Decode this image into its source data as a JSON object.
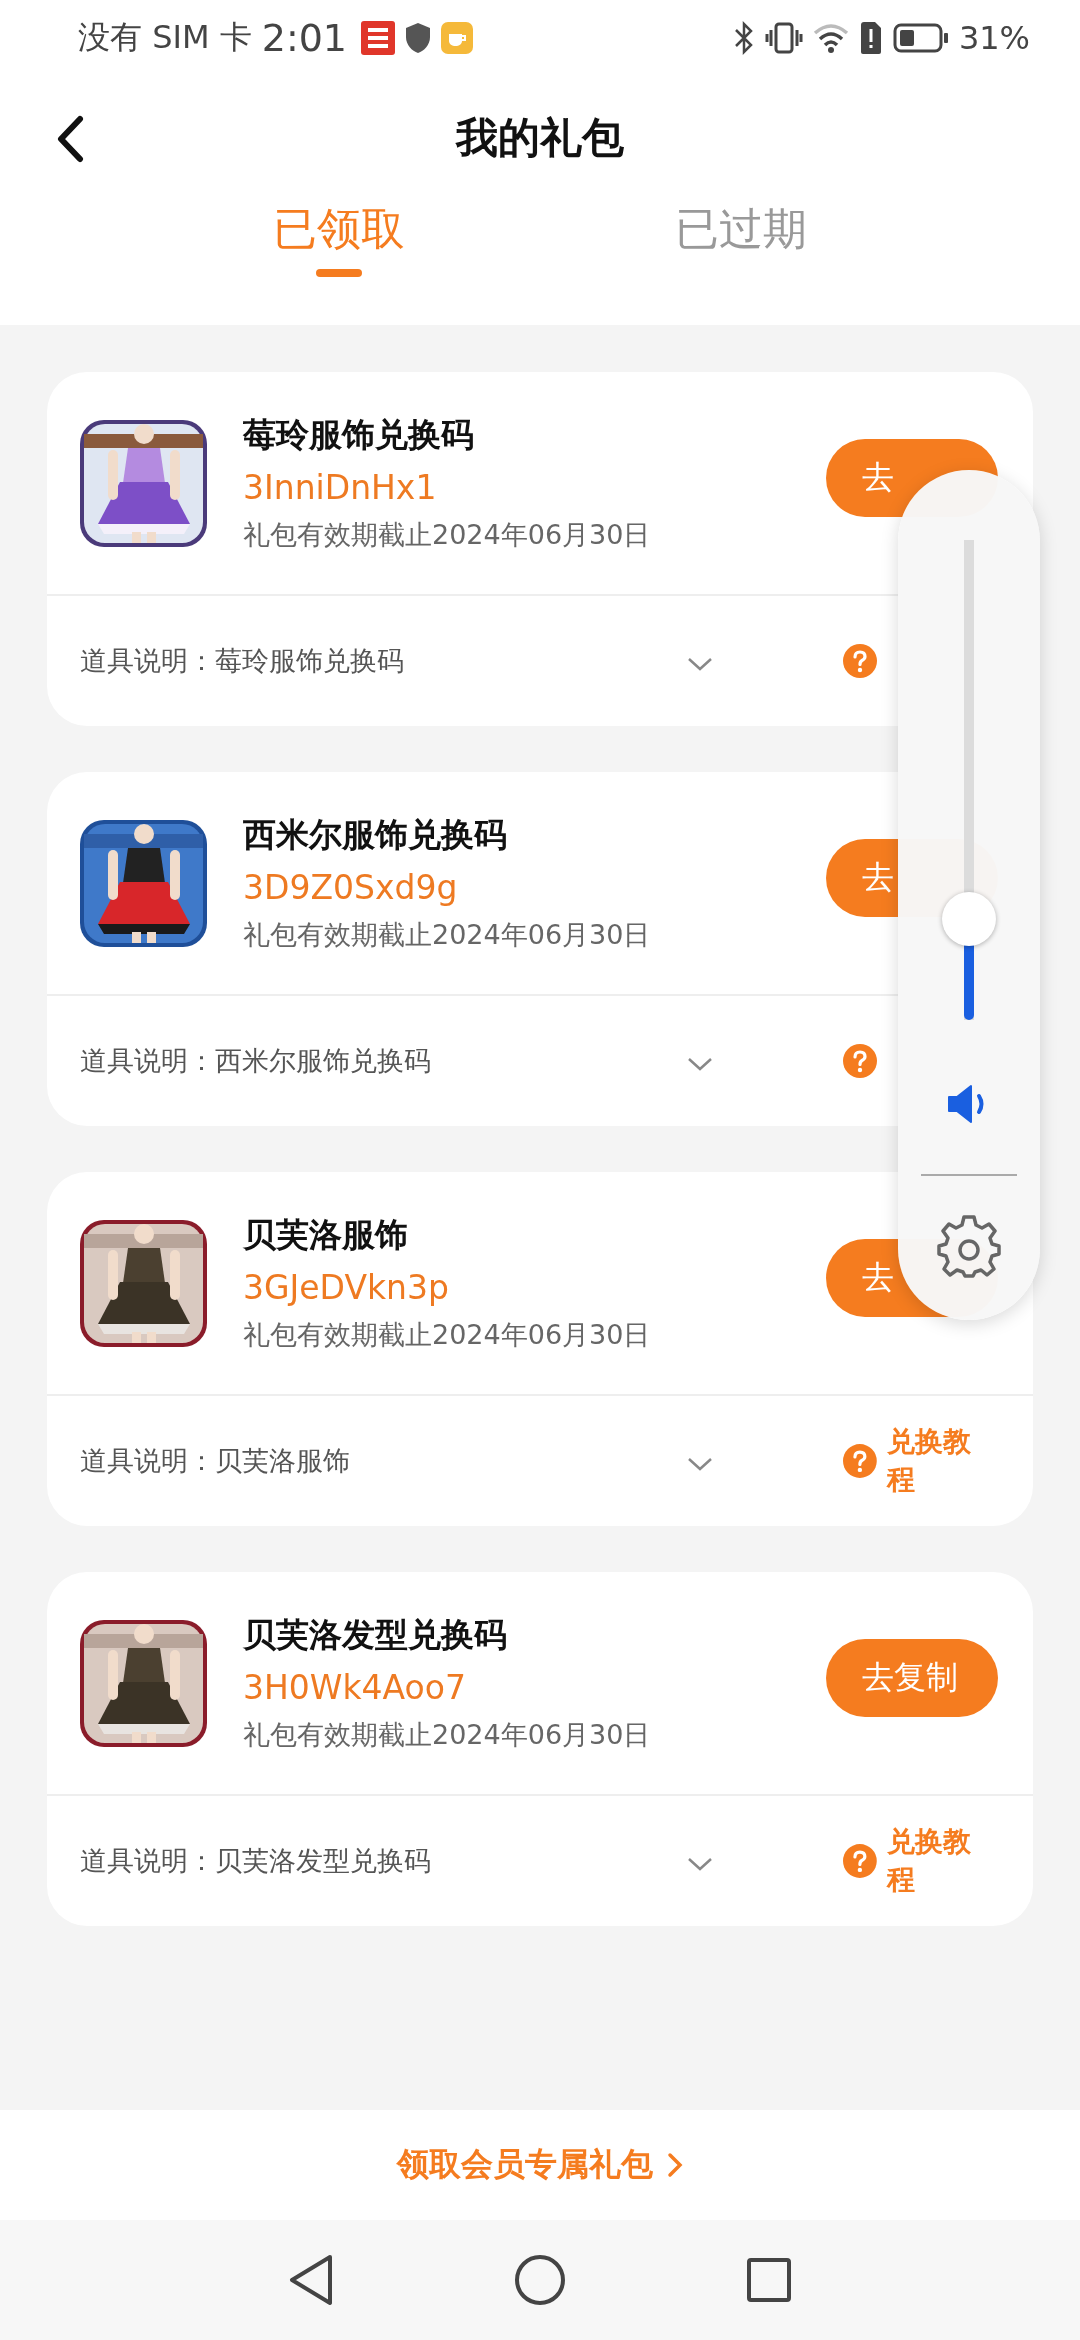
{
  "status_bar": {
    "carrier": "没有 SIM 卡",
    "time": "2:01",
    "battery": "31%"
  },
  "header": {
    "title": "我的礼包"
  },
  "tabs": [
    {
      "label": "已领取",
      "selected": true
    },
    {
      "label": "已过期",
      "selected": false
    }
  ],
  "gifts": [
    {
      "title": "莓玲服饰兑换码",
      "code": "3InniDnHx1",
      "expiry": "礼包有效期截止2024年06月30日",
      "button": "去",
      "description": "道具说明：莓玲服饰兑换码"
    },
    {
      "title": "西米尔服饰兑换码",
      "code": "3D9Z0Sxd9g",
      "expiry": "礼包有效期截止2024年06月30日",
      "button": "去",
      "description": "道具说明：西米尔服饰兑换码"
    },
    {
      "title": "贝芙洛服饰",
      "code": "3GJeDVkn3p",
      "expiry": "礼包有效期截止2024年06月30日",
      "button": "去",
      "description": "道具说明：贝芙洛服饰",
      "help": "兑换教程"
    },
    {
      "title": "贝芙洛发型兑换码",
      "code": "3H0Wk4Aoo7",
      "expiry": "礼包有效期截止2024年06月30日",
      "button": "去复制",
      "description": "道具说明：贝芙洛发型兑换码",
      "help": "兑换教程"
    }
  ],
  "footer": {
    "link": "领取会员专属礼包"
  },
  "volume_panel": {
    "level": 0.21
  }
}
